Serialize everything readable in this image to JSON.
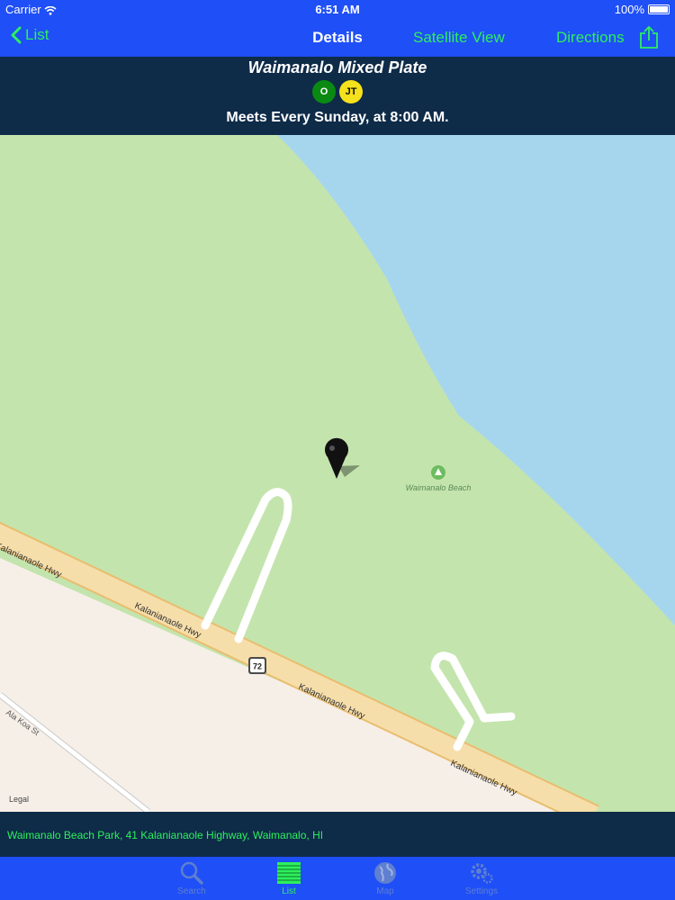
{
  "status": {
    "carrier": "Carrier",
    "time": "6:51 AM",
    "battery": "100%"
  },
  "nav": {
    "back_label": "List",
    "title": "Details",
    "satellite_label": "Satellite View",
    "directions_label": "Directions"
  },
  "header": {
    "venue_name": "Waimanalo Mixed Plate",
    "badges": [
      {
        "text": "O",
        "bg": "#0a8a12",
        "fg": "#ffffff"
      },
      {
        "text": "JT",
        "bg": "#f5e11c",
        "fg": "#111111"
      }
    ],
    "schedule": "Meets Every Sunday, at 8:00 AM."
  },
  "map": {
    "labels": {
      "road_1": "Kalanianaole Hwy",
      "road_2": "Kalanianaole Hwy",
      "road_3": "Kalanianaole Hwy",
      "road_4": "Kalanianaole Hwy",
      "street": "Ala Koa St",
      "beach": "Waimanalo Beach",
      "route": "72"
    },
    "legal": "Legal",
    "colors": {
      "land": "#c4e4ad",
      "water": "#a6d6ee",
      "urban": "#f6efe8",
      "highway": "#f6deaa"
    }
  },
  "address": "Waimanalo Beach Park, 41 Kalanianaole Highway, Waimanalo, HI",
  "tabs": [
    {
      "label": "Search",
      "icon": "search-icon",
      "active": false
    },
    {
      "label": "List",
      "icon": "list-icon",
      "active": true
    },
    {
      "label": "Map",
      "icon": "globe-icon",
      "active": false
    },
    {
      "label": "Settings",
      "icon": "gear-icon",
      "active": false
    }
  ],
  "colors": {
    "accent": "#2df05d",
    "bar_blue": "#1f4ff6",
    "panel_navy": "#0e2b48"
  }
}
